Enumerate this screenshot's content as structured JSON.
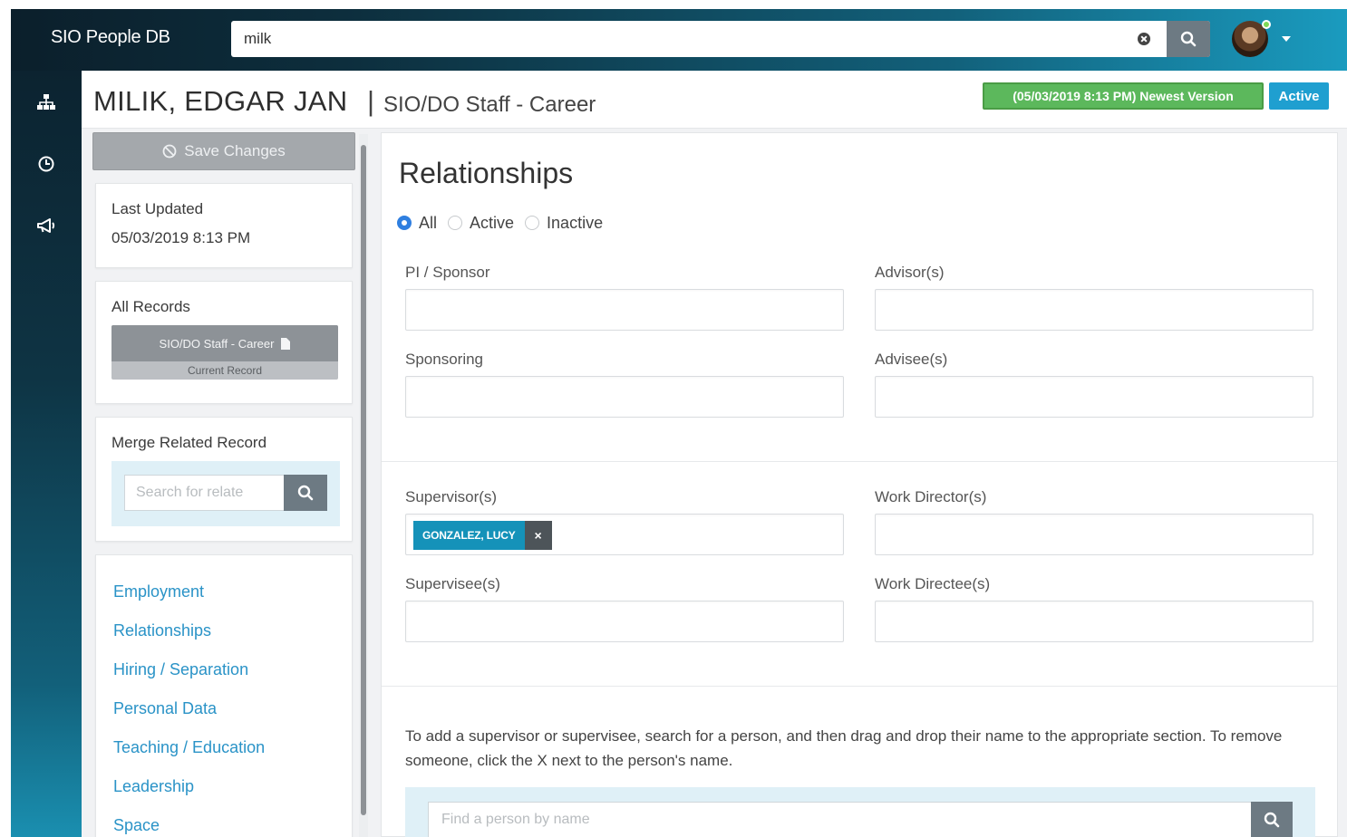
{
  "app": {
    "brand": "SIO People DB"
  },
  "search": {
    "value": "milk",
    "clear_icon": "clear-circle-icon",
    "search_icon": "search-icon"
  },
  "user": {
    "avatar_icon": "avatar",
    "online_color": "#7ed957"
  },
  "rail": {
    "icons": [
      "network-icon",
      "clock-history-icon",
      "megaphone-icon"
    ]
  },
  "header": {
    "name": "MILIK, EDGAR JAN",
    "separator": "|",
    "role": "SIO/DO Staff - Career",
    "version_badge": "(05/03/2019 8:13 PM) Newest Version",
    "status_badge": "Active",
    "version_color": "#5cb85c",
    "status_color": "#1f9fd0"
  },
  "left": {
    "save_label": "Save Changes",
    "last_updated_label": "Last Updated",
    "last_updated_value": "05/03/2019 8:13 PM",
    "all_records_label": "All Records",
    "record_title": "SIO/DO Staff - Career",
    "record_subtitle": "Current Record",
    "merge_label": "Merge Related Record",
    "merge_placeholder": "Search for relate",
    "nav": [
      "Employment",
      "Relationships",
      "Hiring / Separation",
      "Personal Data",
      "Teaching / Education",
      "Leadership",
      "Space"
    ]
  },
  "main": {
    "title": "Relationships",
    "filters": [
      {
        "label": "All",
        "checked": true
      },
      {
        "label": "Active",
        "checked": false
      },
      {
        "label": "Inactive",
        "checked": false
      }
    ],
    "fields": {
      "pi_sponsor": "PI / Sponsor",
      "advisors": "Advisor(s)",
      "sponsoring": "Sponsoring",
      "advisees": "Advisee(s)",
      "supervisors": "Supervisor(s)",
      "work_directors": "Work Director(s)",
      "supervisees": "Supervisee(s)",
      "work_directees": "Work Directee(s)"
    },
    "supervisor_tag": {
      "name": "GONZALEZ, LUCY",
      "remove": "×"
    },
    "help_text": "To add a supervisor or supervisee, search for a person, and then drag and drop their name to the appropriate section. To remove someone, click the X next to the person's name.",
    "find_placeholder": "Find a person by name"
  }
}
